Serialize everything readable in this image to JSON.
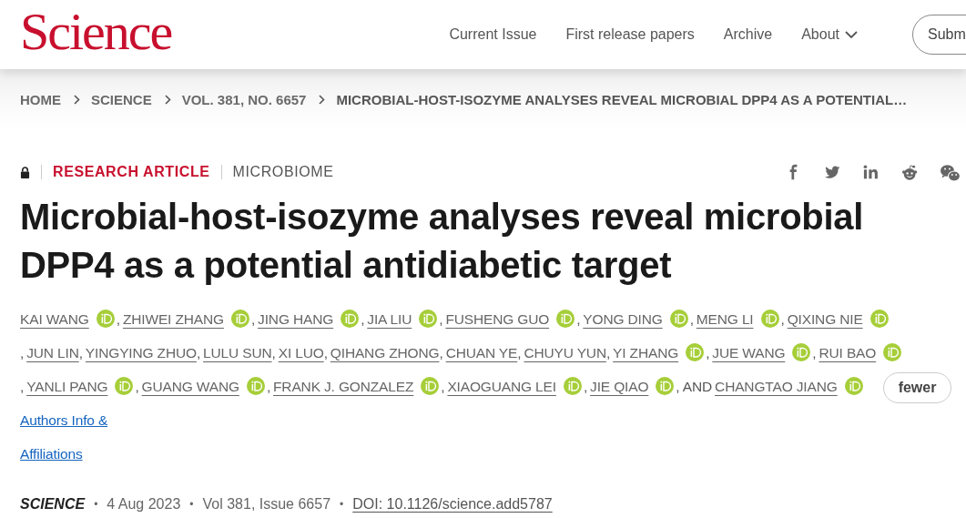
{
  "header": {
    "logo": "Science",
    "nav": [
      {
        "label": "Current Issue",
        "dropdown": false
      },
      {
        "label": "First release papers",
        "dropdown": false
      },
      {
        "label": "Archive",
        "dropdown": false
      },
      {
        "label": "About",
        "dropdown": true
      }
    ],
    "button": "Subm"
  },
  "breadcrumb": [
    "HOME",
    "SCIENCE",
    "VOL. 381, NO. 6657",
    "MICROBIAL-HOST-ISOZYME ANALYSES REVEAL MICROBIAL DPP4 AS A POTENTIAL…"
  ],
  "article": {
    "locked": true,
    "type": "RESEARCH ARTICLE",
    "section": "MICROBIOME",
    "title": "Microbial-host-isozyme analyses reveal microbial DPP4 as a potential antidiabetic target",
    "authors": [
      {
        "name": "KAI WANG",
        "orcid": true,
        "sep": ","
      },
      {
        "name": "ZHIWEI ZHANG",
        "orcid": true,
        "sep": ","
      },
      {
        "name": "JING HANG",
        "orcid": true,
        "sep": ","
      },
      {
        "name": "JIA LIU",
        "orcid": true,
        "sep": ","
      },
      {
        "name": "FUSHENG GUO",
        "orcid": true,
        "sep": ","
      },
      {
        "name": "YONG DING",
        "orcid": true,
        "sep": ","
      },
      {
        "name": "MENG LI",
        "orcid": true,
        "sep": ","
      },
      {
        "name": "QIXING NIE",
        "orcid": true,
        "sep": ","
      },
      {
        "name": "JUN LIN",
        "orcid": false,
        "sep": ","
      },
      {
        "name": "YINGYING ZHUO",
        "orcid": false,
        "sep": ","
      },
      {
        "name": "LULU SUN",
        "orcid": false,
        "sep": ","
      },
      {
        "name": "XI LUO",
        "orcid": false,
        "sep": ","
      },
      {
        "name": "QIHANG ZHONG",
        "orcid": false,
        "sep": ","
      },
      {
        "name": "CHUAN YE",
        "orcid": false,
        "sep": ","
      },
      {
        "name": "CHUYU YUN",
        "orcid": false,
        "sep": ","
      },
      {
        "name": "YI ZHANG",
        "orcid": true,
        "sep": ","
      },
      {
        "name": "JUE WANG",
        "orcid": true,
        "sep": ","
      },
      {
        "name": "RUI BAO",
        "orcid": true,
        "sep": ","
      },
      {
        "name": "YANLI PANG",
        "orcid": true,
        "sep": ","
      },
      {
        "name": "GUANG WANG",
        "orcid": true,
        "sep": ","
      },
      {
        "name": "FRANK J. GONZALEZ",
        "orcid": true,
        "sep": ","
      },
      {
        "name": "XIAOGUANG LEI",
        "orcid": true,
        "sep": ","
      },
      {
        "name": "JIE QIAO",
        "orcid": true,
        "sep": ", AND"
      },
      {
        "name": "CHANGTAO JIANG",
        "orcid": true
      }
    ],
    "fewer_button": "fewer",
    "authors_link": "Authors Info & Affiliations",
    "journal": "SCIENCE",
    "date": "4 Aug 2023",
    "volume": "Vol 381, Issue 6657",
    "doi": "DOI: 10.1126/science.add5787",
    "bullet": "•"
  }
}
